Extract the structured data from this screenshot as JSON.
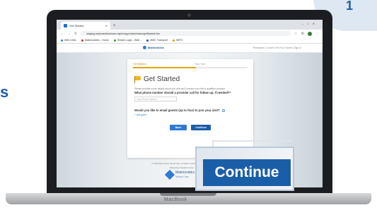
{
  "step_number": "1",
  "side_letter": "s",
  "laptop": {
    "brand": "MacBook"
  },
  "browser": {
    "tab_title": "Get Started",
    "url": "staging.mainmsvirtualcare.org/en/app/visits/intake/getStarted.htm",
    "bookmarks": [
      "Web Links",
      "Mainmonides - Home",
      "Simple Login - Web...",
      "MMC Transport",
      "WIFO"
    ]
  },
  "site": {
    "logo": "Maimonides",
    "logo_sub": "Virtual Care",
    "nav": "Remainder | Covers The Full | Home | Sign In"
  },
  "card": {
    "step1": "Get Started",
    "step2": "Your Visit",
    "title": "Get Started",
    "description": "Please provide some details about you and we'll connect you with a qualified provider.",
    "phone_question": "What phone number should a provider call for follow up, if needed?*",
    "phone_placeholder": "Your Phone Number",
    "guest_question": "Would you like to email guests (up to four) to join your visit?",
    "add_guest": "+ Add guest",
    "back_label": "Back",
    "continue_label": "Continue"
  },
  "footer": {
    "line1": "© 2020 Maimonides Virtual Care. All rights reserved.  |  Terms of Use  |  Privacy Policy  |  Help",
    "line2": "Mainonides Medical Center"
  },
  "callout": {
    "label": "Continue"
  },
  "colors": {
    "primary": "#1b5ea8",
    "accent": "#f2b51c",
    "badge": "#dde8f3"
  }
}
